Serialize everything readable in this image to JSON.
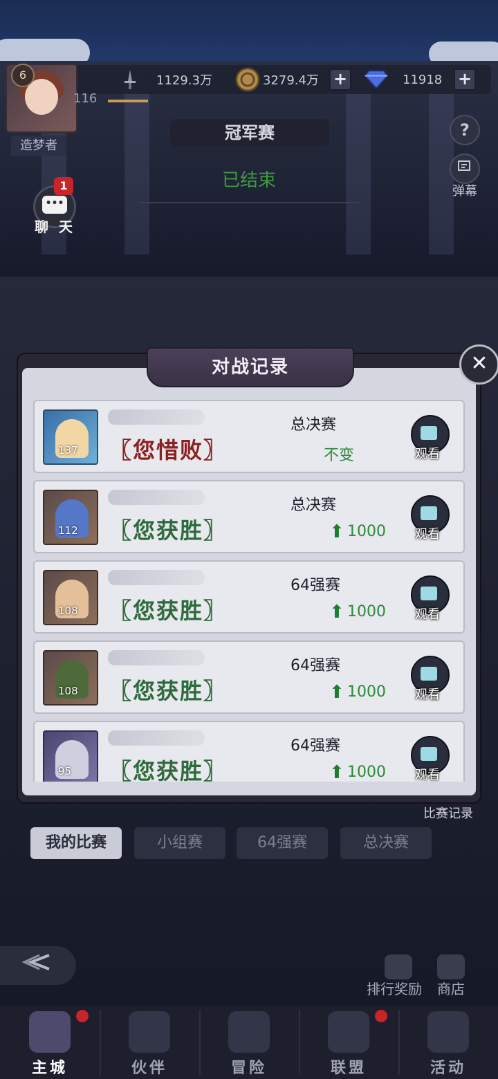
{
  "top_bar": {
    "level": "6",
    "exp": "116",
    "title": "造梦者",
    "power": "1129.3万",
    "gold": "3279.4万",
    "diamond": "11918"
  },
  "stage": {
    "title": "冠军赛",
    "status": "已结束"
  },
  "side_buttons": {
    "help_icon": "?",
    "danmaku_label": "弹幕",
    "chat_label": "聊 天",
    "chat_badge": "1"
  },
  "dialog": {
    "title": "对战记录",
    "close_icon": "✕",
    "records": [
      {
        "level": "137",
        "result": "〖您惜败〗",
        "outcome": "lose",
        "stage": "总决赛",
        "change": "不变",
        "watch": "观看"
      },
      {
        "level": "112",
        "result": "〖您获胜〗",
        "outcome": "win",
        "stage": "总决赛",
        "change": "1000",
        "watch": "观看"
      },
      {
        "level": "108",
        "result": "〖您获胜〗",
        "outcome": "win",
        "stage": "64强赛",
        "change": "1000",
        "watch": "观看"
      },
      {
        "level": "108",
        "result": "〖您获胜〗",
        "outcome": "win",
        "stage": "64强赛",
        "change": "1000",
        "watch": "观看"
      },
      {
        "level": "95",
        "result": "〖您获胜〗",
        "outcome": "win",
        "stage": "64强赛",
        "change": "1000",
        "watch": "观看"
      }
    ]
  },
  "tabs": {
    "record_link": "比赛记录",
    "items": [
      "我的比赛",
      "小组赛",
      "64强赛",
      "总决赛"
    ]
  },
  "lower_actions": {
    "rank_reward": "排行奖励",
    "shop": "商店"
  },
  "nav": {
    "items": [
      "主城",
      "伙伴",
      "冒险",
      "联盟",
      "活动"
    ]
  },
  "colors": {
    "win": "#2e6a3b",
    "lose": "#8c1f1f",
    "status_green": "#3f9a40",
    "badge_red": "#c7252a"
  }
}
